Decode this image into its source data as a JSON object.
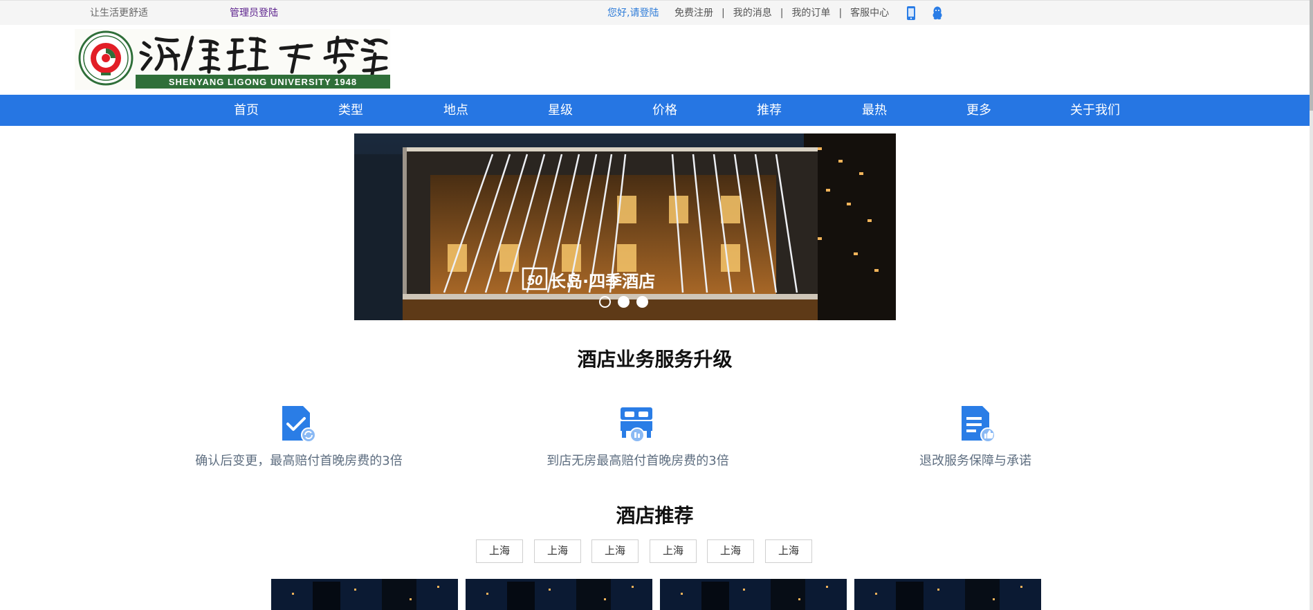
{
  "topbar": {
    "slogan": "让生活更舒适",
    "admin_login": "管理员登陆",
    "greeting": "您好,请登陆",
    "links": [
      "免费注册",
      "我的消息",
      "我的订单",
      "客服中心"
    ],
    "separator": "|",
    "icons": [
      "mobile-phone-icon",
      "qq-icon"
    ]
  },
  "logo": {
    "name_calligraphy": "沈阳理工大学",
    "name_en": "SHENYANG LIGONG UNIVERSITY 1948"
  },
  "nav": {
    "items": [
      "首页",
      "类型",
      "地点",
      "星级",
      "价格",
      "推荐",
      "最热",
      "更多",
      "关于我们"
    ]
  },
  "banner": {
    "hotel_sign": "长岛·四季酒店",
    "sign_badge": "50",
    "slides": 3,
    "active_slide": 1
  },
  "services": {
    "title": "酒店业务服务升级",
    "items": [
      {
        "icon": "document-check-icon",
        "text": "确认后变更，最高赔付首晚房费的3倍"
      },
      {
        "icon": "bed-icon",
        "text": "到店无房最高赔付首晚房费的3倍"
      },
      {
        "icon": "document-thumbs-up-icon",
        "text": "退改服务保障与承诺"
      }
    ]
  },
  "recommend": {
    "title": "酒店推荐",
    "cities": [
      "上海",
      "上海",
      "上海",
      "上海",
      "上海",
      "上海"
    ]
  },
  "colors": {
    "nav_bg": "#2676e3",
    "link_blue": "#2d7bd8",
    "admin_purple": "#5a1f8c",
    "service_text": "#5e6e80",
    "icon_blue": "#2a7de6"
  }
}
